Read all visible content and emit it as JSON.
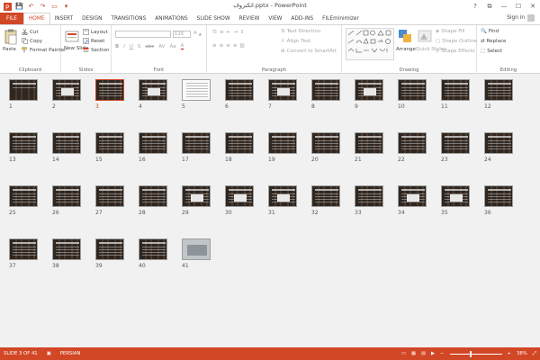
{
  "window": {
    "title": "اثکتروف.pptx - PowerPoint",
    "controls": {
      "help": "?",
      "restore_ribbon": "⧉",
      "minimize": "—",
      "maximize": "☐",
      "close": "✕"
    }
  },
  "qat": {
    "save": "💾",
    "undo": "↶",
    "redo": "↷",
    "start": "▭",
    "customize": "▾"
  },
  "tabs": [
    "FILE",
    "HOME",
    "INSERT",
    "DESIGN",
    "TRANSITIONS",
    "ANIMATIONS",
    "SLIDE SHOW",
    "REVIEW",
    "VIEW",
    "ADD-INS",
    "FILEminimizer"
  ],
  "active_tab": "HOME",
  "signin": "Sign in",
  "ribbon": {
    "clipboard": {
      "label": "Clipboard",
      "paste": "Paste",
      "cut": "Cut",
      "copy": "Copy",
      "format_painter": "Format Painter"
    },
    "slides": {
      "label": "Slides",
      "new_slide": "New Slide",
      "layout": "Layout",
      "reset": "Reset",
      "section": "Section"
    },
    "font": {
      "label": "Font",
      "size": "115"
    },
    "paragraph": {
      "label": "Paragraph",
      "text_direction": "Text Direction",
      "align_text": "Align Text",
      "convert_smartart": "Convert to SmartArt"
    },
    "drawing": {
      "label": "Drawing",
      "arrange": "Arrange",
      "quick_styles": "Quick Styles",
      "shape_fill": "Shape Fill",
      "shape_outline": "Shape Outline",
      "shape_effects": "Shape Effects"
    },
    "editing": {
      "label": "Editing",
      "find": "Find",
      "replace": "Replace",
      "select": "Select"
    }
  },
  "slides": [
    {
      "n": "1",
      "kind": "title"
    },
    {
      "n": "2",
      "kind": "img"
    },
    {
      "n": "3",
      "kind": "text",
      "selected": true
    },
    {
      "n": "4",
      "kind": "img"
    },
    {
      "n": "5",
      "kind": "white"
    },
    {
      "n": "6",
      "kind": "text"
    },
    {
      "n": "7",
      "kind": "img"
    },
    {
      "n": "8",
      "kind": "text"
    },
    {
      "n": "9",
      "kind": "img"
    },
    {
      "n": "10",
      "kind": "text"
    },
    {
      "n": "11",
      "kind": "text"
    },
    {
      "n": "12",
      "kind": "text"
    },
    {
      "n": "13",
      "kind": "text"
    },
    {
      "n": "14",
      "kind": "text"
    },
    {
      "n": "15",
      "kind": "text"
    },
    {
      "n": "16",
      "kind": "text"
    },
    {
      "n": "17",
      "kind": "text"
    },
    {
      "n": "18",
      "kind": "text"
    },
    {
      "n": "19",
      "kind": "text"
    },
    {
      "n": "20",
      "kind": "text"
    },
    {
      "n": "21",
      "kind": "text"
    },
    {
      "n": "22",
      "kind": "text"
    },
    {
      "n": "23",
      "kind": "text"
    },
    {
      "n": "24",
      "kind": "text"
    },
    {
      "n": "25",
      "kind": "text"
    },
    {
      "n": "26",
      "kind": "text"
    },
    {
      "n": "27",
      "kind": "text"
    },
    {
      "n": "28",
      "kind": "text"
    },
    {
      "n": "29",
      "kind": "img"
    },
    {
      "n": "30",
      "kind": "img"
    },
    {
      "n": "31",
      "kind": "img"
    },
    {
      "n": "32",
      "kind": "text"
    },
    {
      "n": "33",
      "kind": "text"
    },
    {
      "n": "34",
      "kind": "img"
    },
    {
      "n": "35",
      "kind": "img"
    },
    {
      "n": "36",
      "kind": "text"
    },
    {
      "n": "37",
      "kind": "text"
    },
    {
      "n": "38",
      "kind": "text"
    },
    {
      "n": "39",
      "kind": "text"
    },
    {
      "n": "40",
      "kind": "text"
    },
    {
      "n": "41",
      "kind": "photo"
    }
  ],
  "status": {
    "slide_info": "SLIDE 3 OF 41",
    "language": "PERSIAN",
    "zoom": "38%",
    "zoom_level": 0.38
  },
  "colors": {
    "accent": "#d24726",
    "slide_bg": "#2f2620"
  }
}
